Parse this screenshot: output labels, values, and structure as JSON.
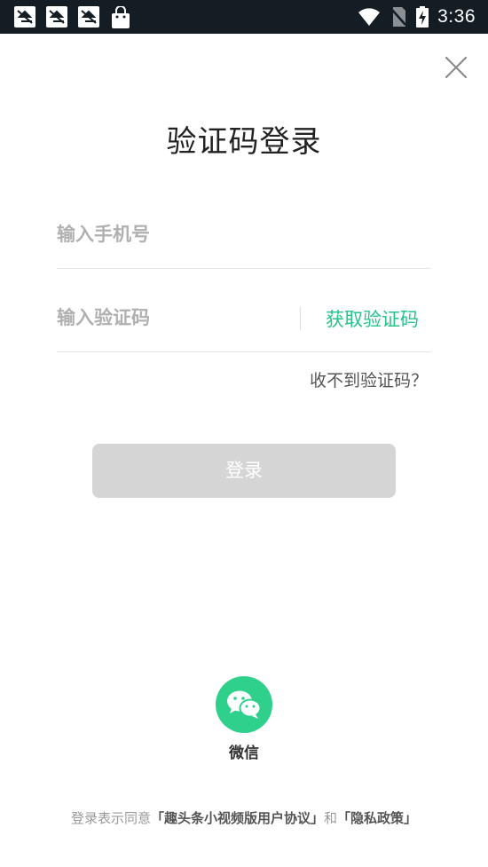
{
  "status_bar": {
    "time": "3:36",
    "notifications": [
      "notification-icon",
      "notification-icon",
      "notification-icon",
      "shopping-bag-icon"
    ],
    "system_icons": [
      "wifi-icon",
      "no-sim-icon",
      "battery-charging-icon"
    ]
  },
  "page": {
    "title": "验证码登录"
  },
  "form": {
    "phone_placeholder": "输入手机号",
    "code_placeholder": "输入验证码",
    "get_code_label": "获取验证码",
    "no_code_label": "收不到验证码？",
    "login_label": "登录"
  },
  "social": {
    "wechat_label": "微信"
  },
  "agreement": {
    "prefix": "登录表示同意",
    "user_agreement": "「趣头条小视频版用户协议」",
    "and": "和",
    "privacy_policy": "「隐私政策」"
  },
  "colors": {
    "accent": "#26c28a",
    "wechat": "#2fcf8c",
    "button_disabled": "#d5d5d5",
    "status_bar": "#141c24"
  }
}
